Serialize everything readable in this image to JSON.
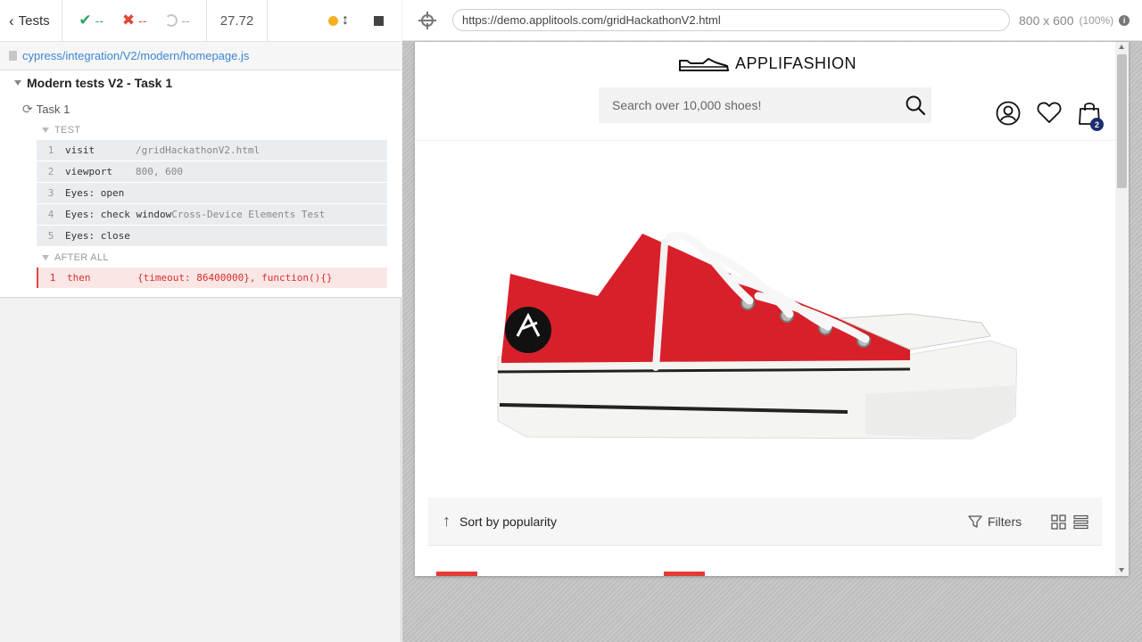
{
  "reporter": {
    "tests_label": "Tests",
    "passed": "--",
    "failed": "--",
    "pending": "--",
    "duration": "27.72",
    "spec_path": "cypress/integration/V2/modern/homepage.js",
    "suite_title": "Modern tests V2 - Task 1",
    "task_title": "Task 1",
    "test_section": "TEST",
    "after_all_section": "AFTER ALL",
    "commands": [
      {
        "num": "1",
        "name": "visit",
        "message": "/gridHackathonV2.html"
      },
      {
        "num": "2",
        "name": "viewport",
        "message": "800, 600"
      },
      {
        "num": "3",
        "name": "Eyes: open",
        "message": ""
      },
      {
        "num": "4",
        "name": "Eyes: check window",
        "message": "Cross-Device Elements Test"
      },
      {
        "num": "5",
        "name": "Eyes: close",
        "message": ""
      }
    ],
    "after_all_commands": [
      {
        "num": "1",
        "name": "then",
        "message": "{timeout: 86400000}, function(){}"
      }
    ],
    "colors": {
      "pass": "#2ca55b",
      "fail": "#e2463c",
      "link": "#3c86d3"
    }
  },
  "aut": {
    "url": "https://demo.applitools.com/gridHackathonV2.html",
    "viewport_size": "800 x 600",
    "zoom": "(100%)",
    "site": {
      "logo_text": "APPLIFASHION",
      "search_placeholder": "Search over 10,000 shoes!",
      "cart_count": "2",
      "sort_label": "Sort by popularity",
      "filters_label": "Filters",
      "accent_color": "#e53935",
      "badge_color": "#1b2e6e"
    }
  }
}
